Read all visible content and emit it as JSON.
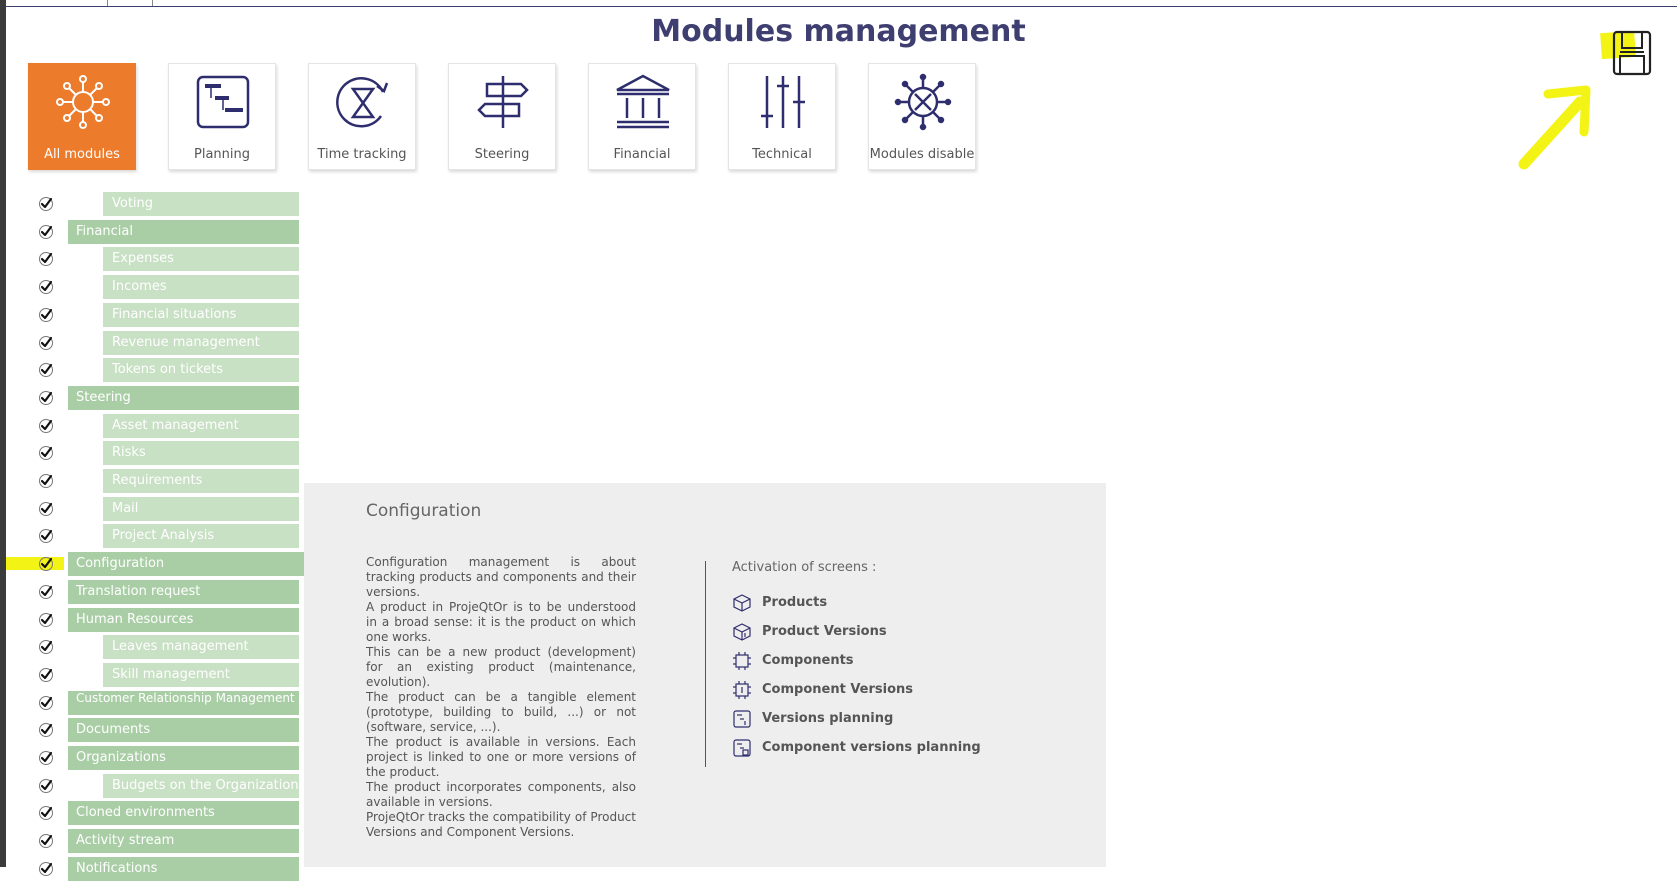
{
  "page": {
    "title": "Modules management"
  },
  "toolbar": {
    "save_icon": "floppy-disk-icon",
    "highlight_color": "#f3f315"
  },
  "colors": {
    "accent": "#ec7b2c",
    "title": "#3e3f70",
    "parent_bar": "#a9cea5",
    "child_bar": "#c8e0c4"
  },
  "tiles": [
    {
      "label": "All modules",
      "icon": "network-gear-icon",
      "active": true
    },
    {
      "label": "Planning",
      "icon": "gantt-icon",
      "active": false
    },
    {
      "label": "Time tracking",
      "icon": "hourglass-icon",
      "active": false
    },
    {
      "label": "Steering",
      "icon": "signpost-icon",
      "active": false
    },
    {
      "label": "Financial",
      "icon": "bank-icon",
      "active": false
    },
    {
      "label": "Technical",
      "icon": "sliders-icon",
      "active": false
    },
    {
      "label": "Modules disable",
      "icon": "disabled-wheel-icon",
      "active": false
    }
  ],
  "modules": [
    {
      "label": "Voting",
      "level": "child",
      "checked": true
    },
    {
      "label": "Financial",
      "level": "parent",
      "checked": true
    },
    {
      "label": "Expenses",
      "level": "child",
      "checked": true
    },
    {
      "label": "Incomes",
      "level": "child",
      "checked": true
    },
    {
      "label": "Financial situations",
      "level": "child",
      "checked": true
    },
    {
      "label": "Revenue management",
      "level": "child",
      "checked": true
    },
    {
      "label": "Tokens on tickets",
      "level": "child",
      "checked": true
    },
    {
      "label": "Steering",
      "level": "parent",
      "checked": true
    },
    {
      "label": "Asset management",
      "level": "child",
      "checked": true
    },
    {
      "label": "Risks",
      "level": "child",
      "checked": true
    },
    {
      "label": "Requirements",
      "level": "child",
      "checked": true
    },
    {
      "label": "Mail",
      "level": "child",
      "checked": true
    },
    {
      "label": "Project Analysis",
      "level": "child",
      "checked": true
    },
    {
      "label": "Configuration",
      "level": "parent",
      "checked": true,
      "selected": true
    },
    {
      "label": "Translation request",
      "level": "parent",
      "checked": true
    },
    {
      "label": "Human Resources",
      "level": "parent",
      "checked": true
    },
    {
      "label": "Leaves management",
      "level": "child",
      "checked": true
    },
    {
      "label": "Skill management",
      "level": "child",
      "checked": true
    },
    {
      "label": "Customer Relationship Management",
      "level": "parent",
      "checked": true
    },
    {
      "label": "Documents",
      "level": "parent",
      "checked": true
    },
    {
      "label": "Organizations",
      "level": "parent",
      "checked": true
    },
    {
      "label": "Budgets on the Organizations",
      "level": "child",
      "checked": true
    },
    {
      "label": "Cloned environments",
      "level": "parent",
      "checked": true
    },
    {
      "label": "Activity stream",
      "level": "parent",
      "checked": true
    },
    {
      "label": "Notifications",
      "level": "parent",
      "checked": true
    }
  ],
  "detail": {
    "title": "Configuration",
    "description": [
      "Configuration management is about tracking products and components and their versions.",
      "A product in ProjeQtOr is to be understood in a broad sense: it is the product on which one works.",
      "This can be a new product (development) for an existing product (maintenance, evolution).",
      "The product can be a tangible element (prototype, building to build, ...) or not (software, service, ...).",
      "The product is available in versions. Each project is linked to one or more versions of the product.",
      "The product incorporates components, also available in versions.",
      "ProjeQtOr tracks the compatibility of Product Versions and Component Versions."
    ],
    "screens_title": "Activation of screens :",
    "screens": [
      {
        "label": "Products",
        "icon": "cube-icon"
      },
      {
        "label": "Product Versions",
        "icon": "cube-version-icon"
      },
      {
        "label": "Components",
        "icon": "chip-icon"
      },
      {
        "label": "Component Versions",
        "icon": "chip-version-icon"
      },
      {
        "label": "Versions planning",
        "icon": "gantt-version-icon"
      },
      {
        "label": "Component versions planning",
        "icon": "gantt-component-icon"
      }
    ]
  }
}
